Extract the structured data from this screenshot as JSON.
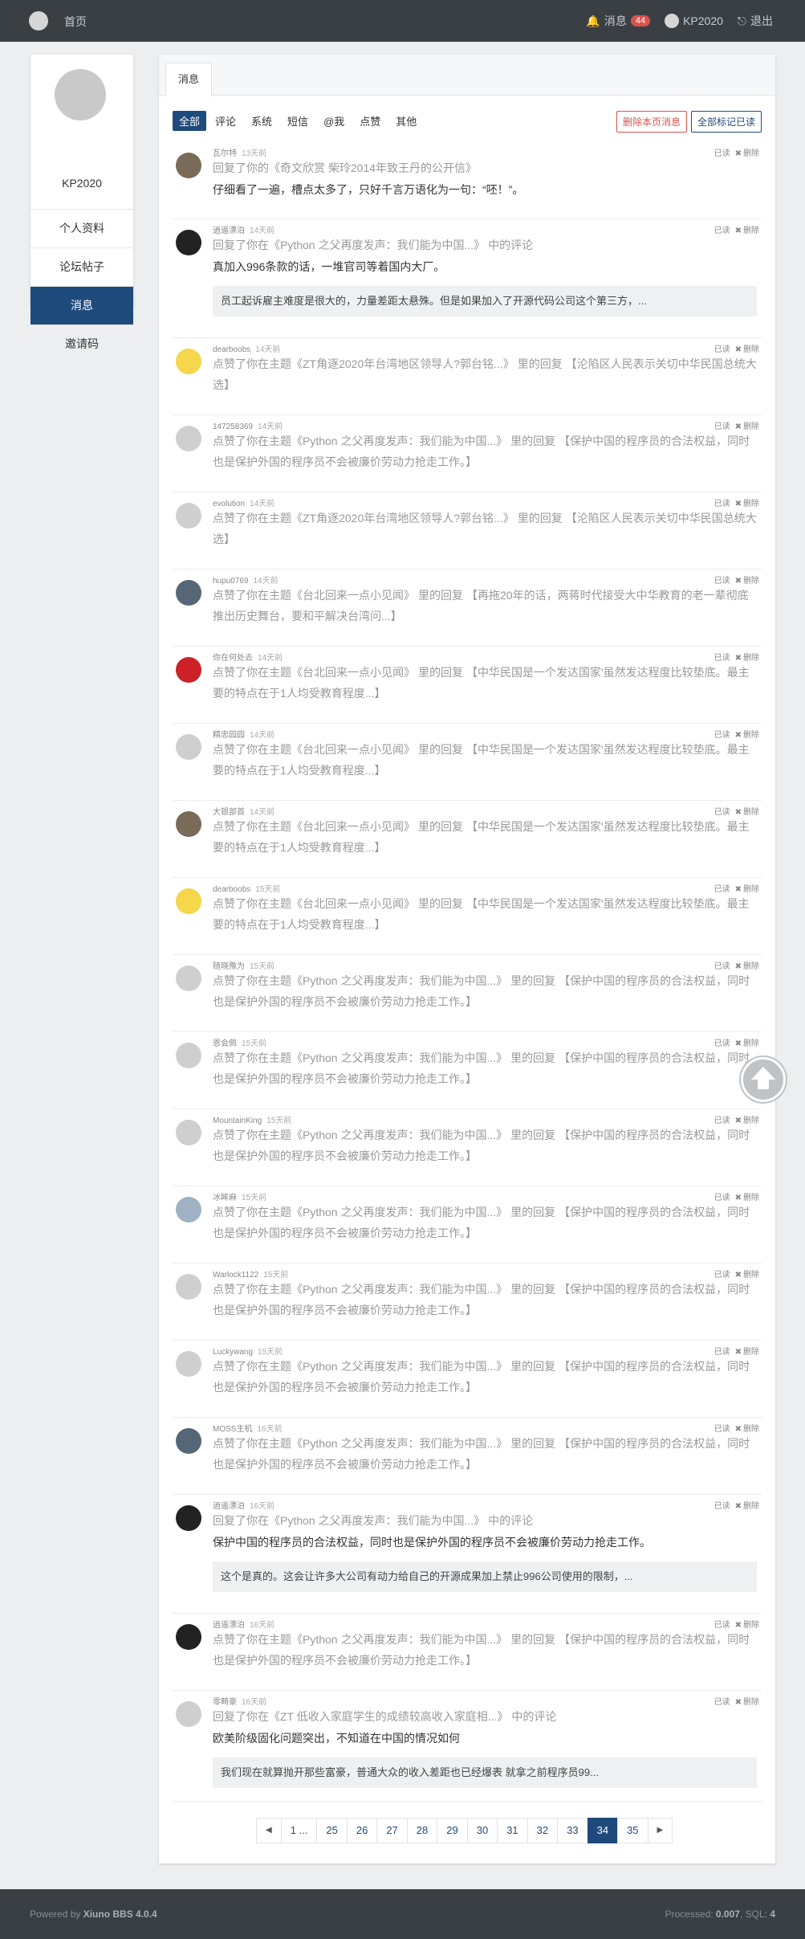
{
  "header": {
    "home": "首页",
    "messages_label": "消息",
    "messages_count": "44",
    "username": "KP2020",
    "logout": "退出"
  },
  "sidebar": {
    "username": "KP2020",
    "items": [
      {
        "label": "个人资料"
      },
      {
        "label": "论坛帖子"
      },
      {
        "label": "消息",
        "active": true
      },
      {
        "label": "邀请码"
      }
    ]
  },
  "tabs": [
    "消息"
  ],
  "filters": [
    "全部",
    "评论",
    "系统",
    "短信",
    "@我",
    "点赞",
    "其他"
  ],
  "actions": {
    "delete_page": "删除本页消息",
    "mark_all": "全部标记已读"
  },
  "ops": {
    "read": "已读",
    "delete": "删除"
  },
  "notices": [
    {
      "user": "瓦尔特",
      "time": "13天前",
      "av": "photo",
      "pre": "回复了你的",
      "link": "《奇文欣赏 柴玲2014年致王丹的公开信》",
      "suf": "",
      "content": "仔细看了一遍，槽点太多了，只好千言万语化为一句：“呸！”。",
      "quote": ""
    },
    {
      "user": "逍遥漂泊",
      "time": "14天前",
      "av": "mask",
      "pre": "回复了你在",
      "link": "《Python 之父再度发声：我们能为中国...》",
      "suf": "中的评论",
      "content": "真加入996条款的话，一堆官司等着国内大厂。",
      "quote": "员工起诉雇主难度是很大的，力量差距太悬殊。但是如果加入了开源代码公司这个第三方，..."
    },
    {
      "user": "dearboobs",
      "time": "14天前",
      "av": "yellow",
      "pre": "点赞了你在主题",
      "link": "《ZT角逐2020年台湾地区领导人?郭台铭...》",
      "suf": "里的回复",
      "quoteinline": "【沦陷区人民表示关切中华民国总统大选】",
      "content": "",
      "quote": ""
    },
    {
      "user": "147258369",
      "time": "14天前",
      "av": "default",
      "pre": "点赞了你在主题",
      "link": "《Python 之父再度发声：我们能为中国...》",
      "suf": "里的回复",
      "quoteinline": "【保护中国的程序员的合法权益，同时也是保护外国的程序员不会被廉价劳动力抢走工作。】",
      "content": "",
      "quote": ""
    },
    {
      "user": "evolution",
      "time": "14天前",
      "av": "default",
      "pre": "点赞了你在主题",
      "link": "《ZT角逐2020年台湾地区领导人?郭台铭...》",
      "suf": "里的回复",
      "quoteinline": "【沦陷区人民表示关切中华民国总统大选】",
      "content": "",
      "quote": ""
    },
    {
      "user": "hupu0769",
      "time": "14天前",
      "av": "dark",
      "pre": "点赞了你在主题",
      "link": "《台北回来一点小见闻》",
      "suf": "里的回复",
      "quoteinline": "【再拖20年的话，两蒋时代接受大中华教育的老一辈彻底推出历史舞台，要和平解决台湾问...】",
      "content": "",
      "quote": ""
    },
    {
      "user": "你在何处去",
      "time": "14天前",
      "av": "red",
      "pre": "点赞了你在主题",
      "link": "《台北回来一点小见闻》",
      "suf": "里的回复",
      "quoteinline": "【中华民国是一个发达国家'虽然发达程度比较垫底。最主要的特点在于1人均受教育程度...】",
      "content": "",
      "quote": ""
    },
    {
      "user": "精忠园园",
      "time": "14天前",
      "av": "default",
      "pre": "点赞了你在主题",
      "link": "《台北回来一点小见闻》",
      "suf": "里的回复",
      "quoteinline": "【中华民国是一个发达国家'虽然发达程度比较垫底。最主要的特点在于1人均受教育程度...】",
      "content": "",
      "quote": ""
    },
    {
      "user": "大银部首",
      "time": "14天前",
      "av": "photo",
      "pre": "点赞了你在主题",
      "link": "《台北回来一点小见闻》",
      "suf": "里的回复",
      "quoteinline": "【中华民国是一个发达国家'虽然发达程度比较垫底。最主要的特点在于1人均受教育程度...】",
      "content": "",
      "quote": ""
    },
    {
      "user": "dearboobs",
      "time": "15天前",
      "av": "yellow",
      "pre": "点赞了你在主题",
      "link": "《台北回来一点小见闻》",
      "suf": "里的回复",
      "quoteinline": "【中华民国是一个发达国家'虽然发达程度比较垫底。最主要的特点在于1人均受教育程度...】",
      "content": "",
      "quote": ""
    },
    {
      "user": "随晓豫为",
      "time": "15天前",
      "av": "default",
      "pre": "点赞了你在主题",
      "link": "《Python 之父再度发声：我们能为中国...》",
      "suf": "里的回复",
      "quoteinline": "【保护中国的程序员的合法权益，同时也是保护外国的程序员不会被廉价劳动力抢走工作。】",
      "content": "",
      "quote": ""
    },
    {
      "user": "恩会佩",
      "time": "15天前",
      "av": "default",
      "pre": "点赞了你在主题",
      "link": "《Python 之父再度发声：我们能为中国...》",
      "suf": "里的回复",
      "quoteinline": "【保护中国的程序员的合法权益，同时也是保护外国的程序员不会被廉价劳动力抢走工作。】",
      "content": "",
      "quote": ""
    },
    {
      "user": "MountainKing",
      "time": "15天前",
      "av": "default",
      "pre": "点赞了你在主题",
      "link": "《Python 之父再度发声：我们能为中国...》",
      "suf": "里的回复",
      "quoteinline": "【保护中国的程序员的合法权益，同时也是保护外国的程序员不会被廉价劳动力抢走工作。】",
      "content": "",
      "quote": ""
    },
    {
      "user": "冰眸麻",
      "time": "15天前",
      "av": "sky",
      "pre": "点赞了你在主题",
      "link": "《Python 之父再度发声：我们能为中国...》",
      "suf": "里的回复",
      "quoteinline": "【保护中国的程序员的合法权益，同时也是保护外国的程序员不会被廉价劳动力抢走工作。】",
      "content": "",
      "quote": ""
    },
    {
      "user": "Warlock1122",
      "time": "15天前",
      "av": "default",
      "pre": "点赞了你在主题",
      "link": "《Python 之父再度发声：我们能为中国...》",
      "suf": "里的回复",
      "quoteinline": "【保护中国的程序员的合法权益，同时也是保护外国的程序员不会被廉价劳动力抢走工作。】",
      "content": "",
      "quote": ""
    },
    {
      "user": "Luckywang",
      "time": "15天前",
      "av": "default",
      "pre": "点赞了你在主题",
      "link": "《Python 之父再度发声：我们能为中国...》",
      "suf": "里的回复",
      "quoteinline": "【保护中国的程序员的合法权益，同时也是保护外国的程序员不会被廉价劳动力抢走工作。】",
      "content": "",
      "quote": ""
    },
    {
      "user": "MOSS主机",
      "time": "16天前",
      "av": "dark",
      "pre": "点赞了你在主题",
      "link": "《Python 之父再度发声：我们能为中国...》",
      "suf": "里的回复",
      "quoteinline": "【保护中国的程序员的合法权益，同时也是保护外国的程序员不会被廉价劳动力抢走工作。】",
      "content": "",
      "quote": ""
    },
    {
      "user": "逍遥漂泊",
      "time": "16天前",
      "av": "mask",
      "pre": "回复了你在",
      "link": "《Python 之父再度发声：我们能为中国...》",
      "suf": "中的评论",
      "content": "保护中国的程序员的合法权益，同时也是保护外国的程序员不会被廉价劳动力抢走工作。",
      "quote": "这个是真的。这会让许多大公司有动力给自己的开源成果加上禁止996公司使用的限制，..."
    },
    {
      "user": "逍遥漂泊",
      "time": "16天前",
      "av": "mask",
      "pre": "点赞了你在主题",
      "link": "《Python 之父再度发声：我们能为中国...》",
      "suf": "里的回复",
      "quoteinline": "【保护中国的程序员的合法权益，同时也是保护外国的程序员不会被廉价劳动力抢走工作。】",
      "content": "",
      "quote": ""
    },
    {
      "user": "零畸豪",
      "time": "16天前",
      "av": "default",
      "pre": "回复了你在",
      "link": "《ZT 低收入家庭学生的成绩较高收入家庭相...》",
      "suf": "中的评论",
      "content": "欧美阶级固化问题突出，不知道在中国的情况如何",
      "quote": "我们现在就算抛开那些富豪，普通大众的收入差距也已经爆表 就拿之前程序员99..."
    }
  ],
  "pagination": [
    "◀",
    "1 ...",
    "25",
    "26",
    "27",
    "28",
    "29",
    "30",
    "31",
    "32",
    "33",
    "34",
    "35",
    "▶"
  ],
  "pagination_active": "34",
  "footer": {
    "powered_prefix": "Powered by ",
    "powered_name": "Xiuno BBS 4.0.4",
    "processed_prefix": "Processed: ",
    "processed_value": "0.007",
    "sql_prefix": ", SQL: ",
    "sql_value": "4"
  },
  "colors": {
    "accent": "#1f4a7c",
    "danger": "#d9534f",
    "topbar": "#3a3f44"
  }
}
